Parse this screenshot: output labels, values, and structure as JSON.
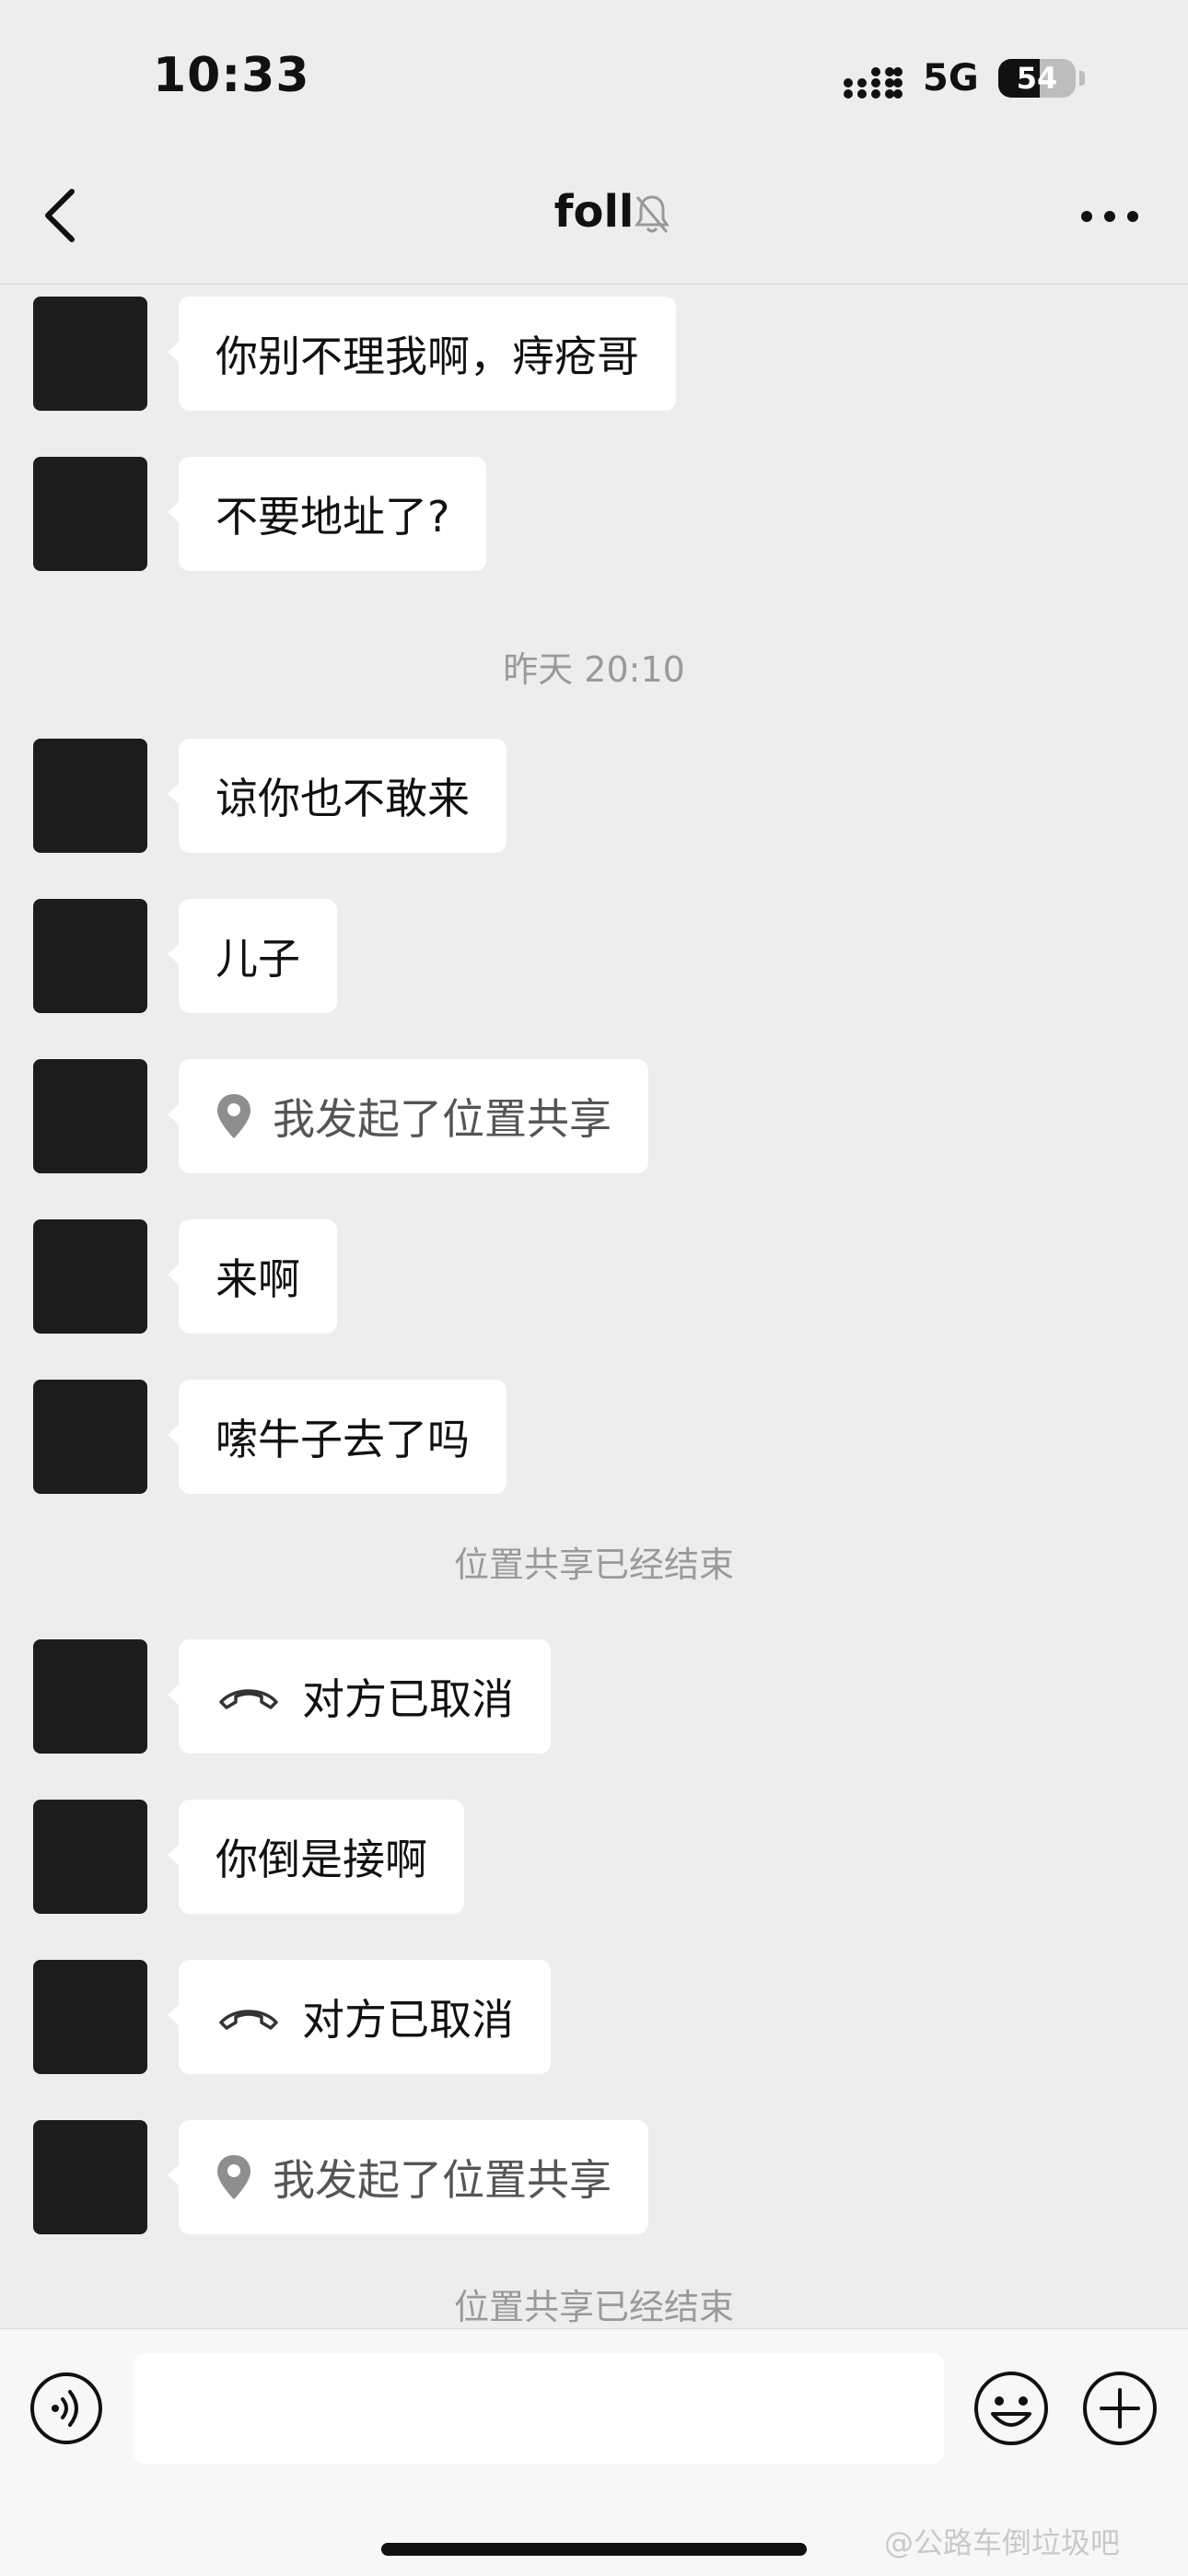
{
  "status": {
    "time": "10:33",
    "network": "5G",
    "battery": "54",
    "battery_percent": 54
  },
  "header": {
    "title": "foll",
    "back_icon": "chevron-left-icon",
    "mute_icon": "bell-slash-icon",
    "more_icon": "ellipsis-icon"
  },
  "messages": [
    {
      "text": "你别不理我啊，痔疮哥"
    },
    {
      "text": "不要地址了?"
    },
    {
      "text": "谅你也不敢来"
    },
    {
      "text": "儿子"
    },
    {
      "text": "我发起了位置共享",
      "icon": "location-pin-icon"
    },
    {
      "text": "来啊"
    },
    {
      "text": "嗦牛子去了吗"
    },
    {
      "text": "对方已取消",
      "icon": "phone-hangup-icon"
    },
    {
      "text": "你倒是接啊"
    },
    {
      "text": "对方已取消",
      "icon": "phone-hangup-icon"
    },
    {
      "text": "我发起了位置共享",
      "icon": "location-pin-icon"
    }
  ],
  "system": {
    "timestamp": "昨天 20:10",
    "location_end_1": "位置共享已经结束",
    "location_end_2": "位置共享已经结束"
  },
  "input": {
    "placeholder": "",
    "voice_icon": "voice-icon",
    "emoji_icon": "emoji-icon",
    "plus_icon": "plus-icon"
  },
  "watermark": "@公路车倒垃圾吧"
}
